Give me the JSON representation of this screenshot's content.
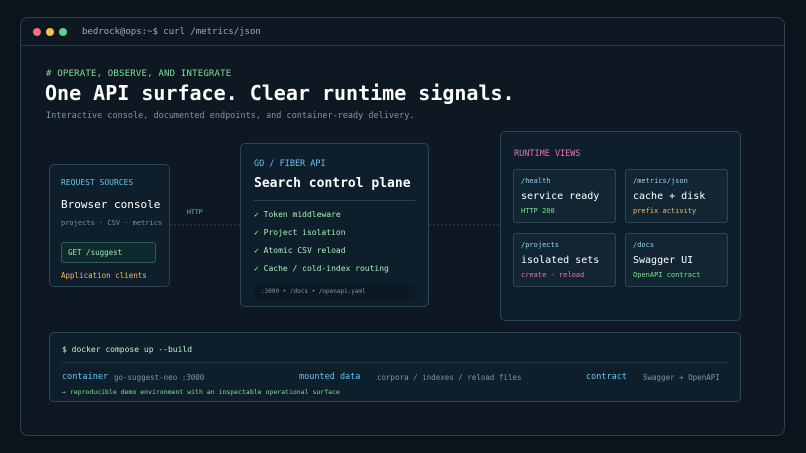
{
  "window": {
    "title": "bedrock@ops:~$ curl /metrics/json"
  },
  "hero": {
    "kicker": "# OPERATE, OBSERVE, AND INTEGRATE",
    "headline": "One API surface. Clear runtime signals.",
    "subline": "Interactive console, documented endpoints, and container-ready delivery."
  },
  "request_sources": {
    "header": "REQUEST SOURCES",
    "name": "Browser console",
    "meta": "projects · CSV · metrics",
    "endpoint": "GET /suggest",
    "clients": "Application clients"
  },
  "connector_label": "HTTP",
  "api": {
    "header": "GO / FIBER API",
    "name": "Search control plane",
    "features": [
      "✓ Token middleware",
      "✓ Project isolation",
      "✓ Atomic CSV reload",
      "✓ Cache / cold-index routing"
    ],
    "footer": ":3000 • /docs • /openapi.yaml"
  },
  "runtime": {
    "header": "RUNTIME VIEWS",
    "tiles": [
      {
        "path": "/health",
        "title": "service ready",
        "status": "HTTP 200",
        "status_color": "#7ee08f"
      },
      {
        "path": "/metrics/json",
        "title": "cache + disk",
        "status": "prefix activity",
        "status_color": "#f2b968"
      },
      {
        "path": "/projects",
        "title": "isolated sets",
        "status": "create - reload",
        "status_color": "#e674b8"
      },
      {
        "path": "/docs",
        "title": "Swagger UI",
        "status": "OpenAPI contract",
        "status_color": "#7ee08f"
      }
    ]
  },
  "docker": {
    "command": "$ docker compose up --build",
    "items": [
      {
        "key": "container",
        "value": "go-suggest-neo :3000"
      },
      {
        "key": "mounted data",
        "value": "corpora / indexes / reload files"
      },
      {
        "key": "contract",
        "value": "Swagger + OpenAPI"
      }
    ],
    "note": "→ reproducible demo environment with an inspectable operational surface"
  },
  "colors": {
    "background": "#0b131c",
    "accent_blue": "#66c3f0",
    "accent_green": "#7ee08f",
    "accent_orange": "#f2b968",
    "accent_pink": "#e674b8"
  }
}
